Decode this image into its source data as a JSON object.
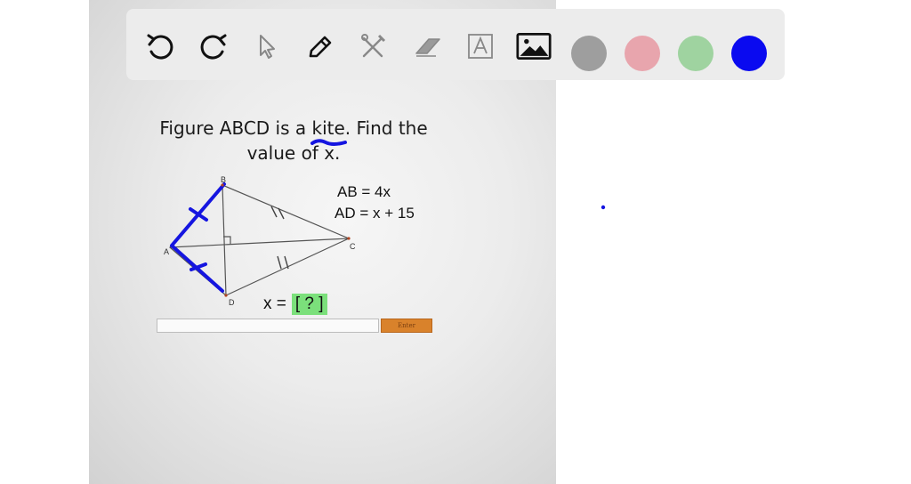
{
  "toolbar": {
    "tools": [
      "undo-icon",
      "redo-icon",
      "pointer-icon",
      "pen-icon",
      "tools-icon",
      "eraser-icon",
      "text-box-icon",
      "image-icon"
    ],
    "colors": [
      "#9e9e9e",
      "#e8a5ad",
      "#9fd3a0",
      "#0a0af0"
    ]
  },
  "question": {
    "line1": "Figure ABCD is a kite. Find the",
    "line2": "value of x."
  },
  "equations": {
    "ab": "AB = 4x",
    "ad": "AD = x + 15"
  },
  "vertices": {
    "a": "A",
    "b": "B",
    "c": "C",
    "d": "D"
  },
  "answer": {
    "prefix": "x =",
    "box": "[ ? ]"
  },
  "enter_label": "Enter",
  "ink_color": "#1515e0"
}
